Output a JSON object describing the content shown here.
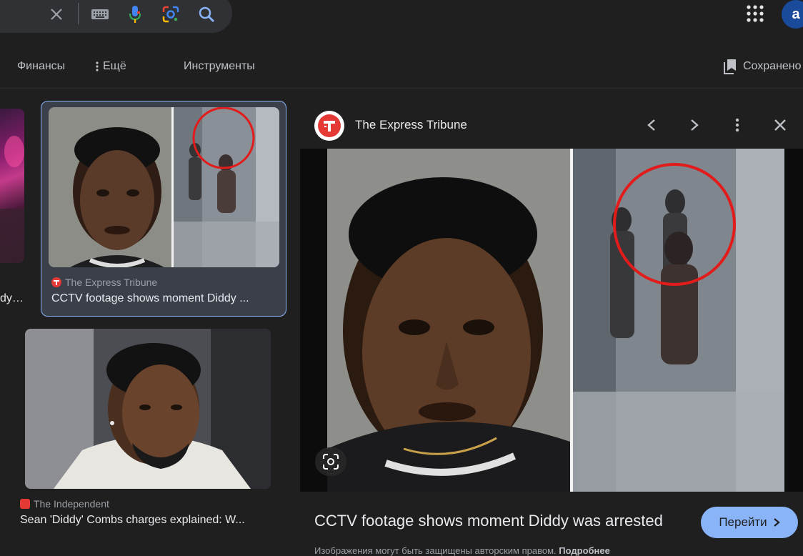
{
  "header": {
    "icons": [
      "close-icon",
      "keyboard-icon",
      "mic-icon",
      "lens-icon",
      "search-icon"
    ],
    "account_initial": "a"
  },
  "tabs": {
    "finance": "Финансы",
    "more": "Ещё",
    "tools": "Инструменты",
    "saved": "Сохранено"
  },
  "results": [
    {
      "source": "",
      "title": "dy…"
    },
    {
      "source": "The Express Tribune",
      "title": "CCTV footage shows moment Diddy ..."
    },
    {
      "source": "The Independent",
      "title": "Sean 'Diddy' Combs charges explained: W..."
    }
  ],
  "preview": {
    "source": "The Express Tribune",
    "title": "CCTV footage shows moment Diddy was arrested",
    "goto_label": "Перейти",
    "note_text": "Изображения могут быть защищены авторским правом.",
    "note_link": "Подробнее"
  },
  "colors": {
    "accent": "#8ab4f8",
    "brand_red": "#e53935",
    "background": "#1f1f1f"
  }
}
